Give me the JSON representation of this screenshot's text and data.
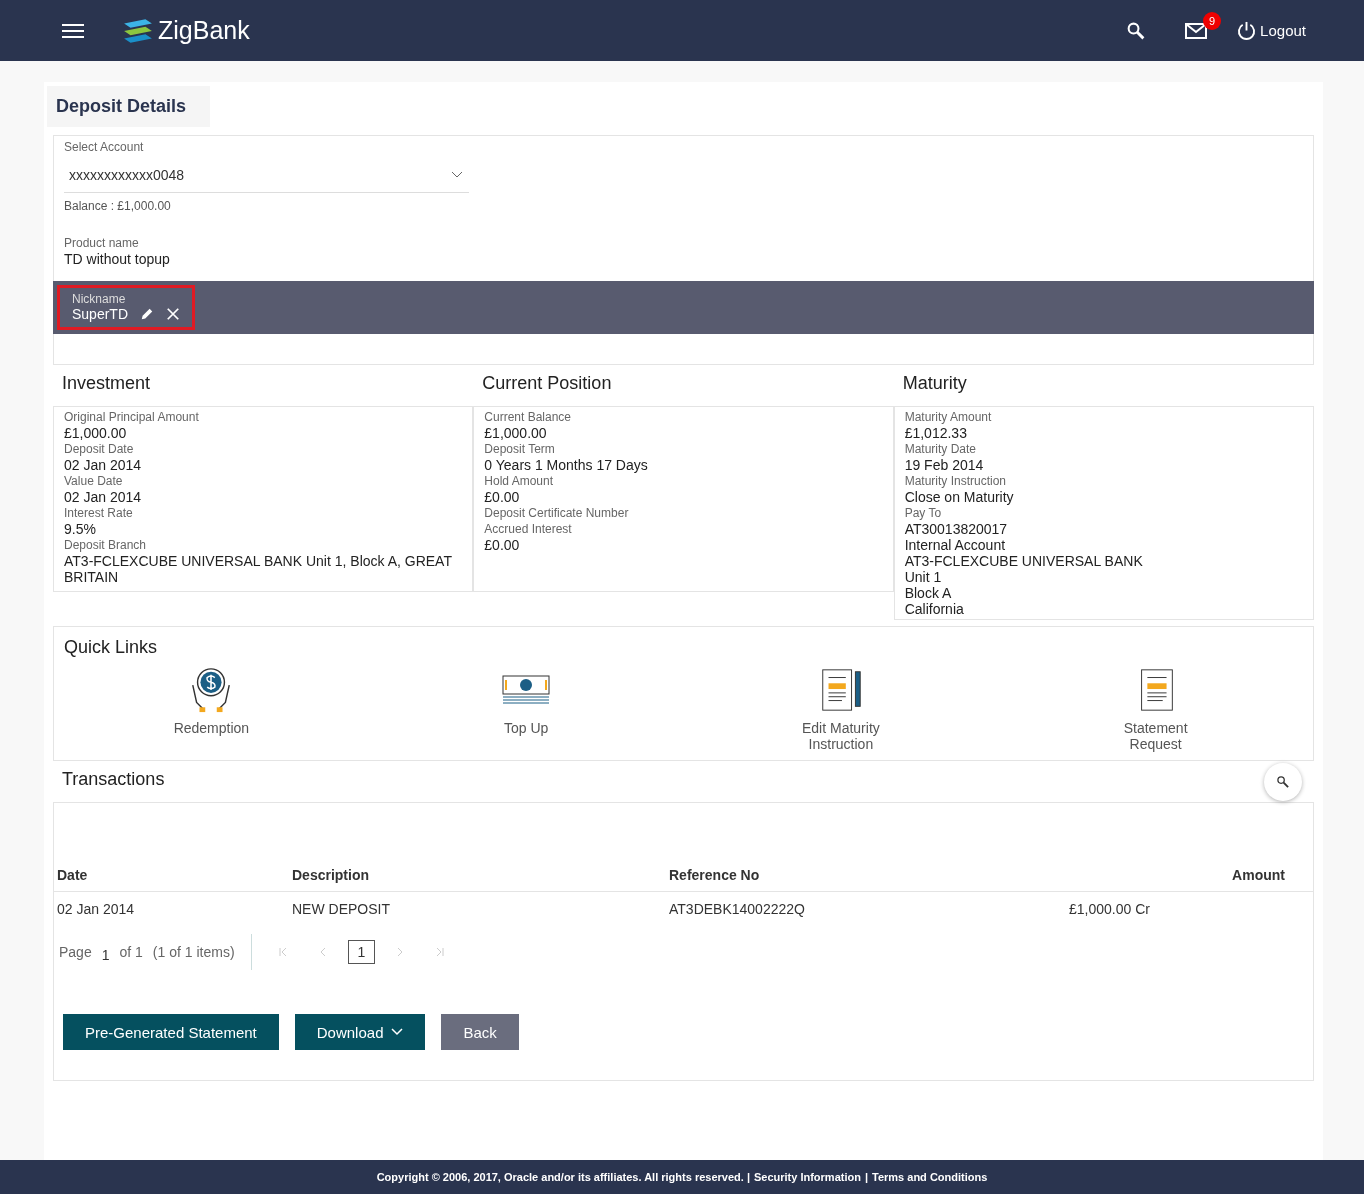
{
  "header": {
    "brand": "ZigBank",
    "mail_badge": "9",
    "logout": "Logout"
  },
  "page_title": "Deposit Details",
  "account": {
    "label": "Select Account",
    "value": "xxxxxxxxxxxx0048",
    "balance": "Balance : £1,000.00",
    "product_label": "Product name",
    "product": "TD without topup"
  },
  "nickname": {
    "label": "Nickname",
    "value": "SuperTD"
  },
  "sections": [
    {
      "title": "Investment",
      "fields": [
        {
          "label": "Original Principal Amount",
          "lines": [
            "£1,000.00"
          ]
        },
        {
          "label": "Deposit Date",
          "lines": [
            "02 Jan 2014"
          ]
        },
        {
          "label": "Value Date",
          "lines": [
            "02 Jan 2014"
          ]
        },
        {
          "label": "Interest Rate",
          "lines": [
            "9.5%"
          ]
        },
        {
          "label": "Deposit Branch",
          "lines": [
            "AT3-FCLEXCUBE UNIVERSAL BANK Unit 1, Block A, GREAT BRITAIN"
          ]
        }
      ]
    },
    {
      "title": "Current Position",
      "fields": [
        {
          "label": "Current Balance",
          "lines": [
            "£1,000.00"
          ]
        },
        {
          "label": "Deposit Term",
          "lines": [
            "0 Years 1 Months 17 Days"
          ]
        },
        {
          "label": "Hold Amount",
          "lines": [
            "£0.00"
          ]
        },
        {
          "label": "Deposit Certificate Number"
        },
        {
          "label": "Accrued Interest",
          "lines": [
            "£0.00"
          ]
        }
      ]
    },
    {
      "title": "Maturity",
      "fields": [
        {
          "label": "Maturity Amount",
          "lines": [
            "£1,012.33"
          ]
        },
        {
          "label": "Maturity Date",
          "lines": [
            "19 Feb 2014"
          ]
        },
        {
          "label": "Maturity Instruction",
          "lines": [
            "Close on Maturity"
          ]
        },
        {
          "label": "Pay To",
          "lines": [
            "AT30013820017",
            "Internal Account",
            "AT3-FCLEXCUBE UNIVERSAL BANK",
            "Unit 1",
            "Block A",
            "California"
          ]
        }
      ]
    }
  ],
  "quick_links": {
    "title": "Quick Links",
    "items": [
      {
        "kind": "hands",
        "label": "Redemption"
      },
      {
        "kind": "cash",
        "label": "Top Up"
      },
      {
        "kind": "pen",
        "label": "Edit Maturity Instruction"
      },
      {
        "kind": "doc",
        "label": "Statement Request"
      }
    ]
  },
  "transactions": {
    "title": "Transactions",
    "columns": [
      "Date",
      "Description",
      "Reference No",
      "Amount"
    ],
    "rows": [
      {
        "date": "02 Jan 2014",
        "description": "NEW DEPOSIT",
        "reference": "AT3DEBK14002222Q",
        "amount": "£1,000.00 Cr"
      }
    ],
    "pager": {
      "page_label": "Page",
      "page": "1",
      "of": "of 1",
      "items": "(1 of 1 items)",
      "current": "1"
    }
  },
  "buttons": [
    {
      "kind": "primary",
      "label": "Pre-Generated Statement"
    },
    {
      "kind": "dropdown",
      "label": "Download"
    },
    {
      "kind": "secondary",
      "label": "Back"
    }
  ],
  "footer": {
    "copyright": "Copyright © 2006, 2017, Oracle and/or its affiliates. All rights reserved. |",
    "links": [
      "Security Information",
      "|",
      "Terms and Conditions"
    ]
  }
}
